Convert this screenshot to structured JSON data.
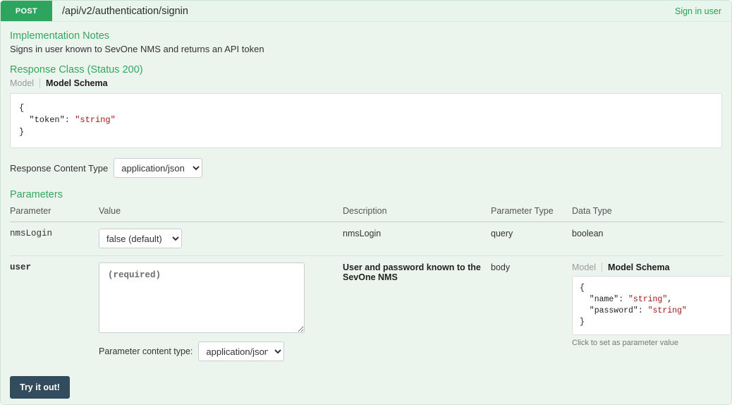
{
  "header": {
    "method": "POST",
    "path": "/api/v2/authentication/signin",
    "summary": "Sign in user"
  },
  "notes": {
    "title": "Implementation Notes",
    "text": "Signs in user known to SevOne NMS and returns an API token"
  },
  "response_class": {
    "title": "Response Class (Status 200)",
    "tab_model": "Model",
    "tab_model_schema": "Model Schema",
    "schema_code": "{\n  \"token\": ",
    "schema_code_string": "\"string\"",
    "schema_code_end": "\n}"
  },
  "response_content_type": {
    "label": "Response Content Type",
    "selected": "application/json",
    "options": [
      "application/json"
    ]
  },
  "parameters_section": {
    "title": "Parameters",
    "columns": {
      "parameter": "Parameter",
      "value": "Value",
      "description": "Description",
      "parameter_type": "Parameter Type",
      "data_type": "Data Type"
    },
    "rows": [
      {
        "name": "nmsLogin",
        "value_selected": "false (default)",
        "value_options": [
          "false (default)",
          "true"
        ],
        "description": "nmsLogin",
        "parameter_type": "query",
        "data_type": "boolean"
      },
      {
        "name": "user",
        "value_placeholder": "(required)",
        "value_text": "",
        "description": "User and password known to the SevOne NMS",
        "parameter_type": "body",
        "data_type_tab_model": "Model",
        "data_type_tab_model_schema": "Model Schema",
        "data_type_code_l1": "{",
        "data_type_code_l2_key": "  \"name\": ",
        "data_type_code_l2_val": "\"string\"",
        "data_type_code_l2_end": ",",
        "data_type_code_l3_key": "  \"password\": ",
        "data_type_code_l3_val": "\"string\"",
        "data_type_code_l4": "}",
        "data_type_hint": "Click to set as parameter value",
        "content_type_label": "Parameter content type:",
        "content_type_selected": "application/json",
        "content_type_options": [
          "application/json"
        ]
      }
    ]
  },
  "submit": {
    "label": "Try it out!"
  },
  "colors": {
    "accent_green": "#2ea55f",
    "link_green": "#23a455",
    "heading_green": "#33a760",
    "page_bg": "#ecf4ee",
    "header_bg": "#e7f5ec",
    "button_navy": "#324b5d",
    "code_string_red": "#a31515"
  }
}
